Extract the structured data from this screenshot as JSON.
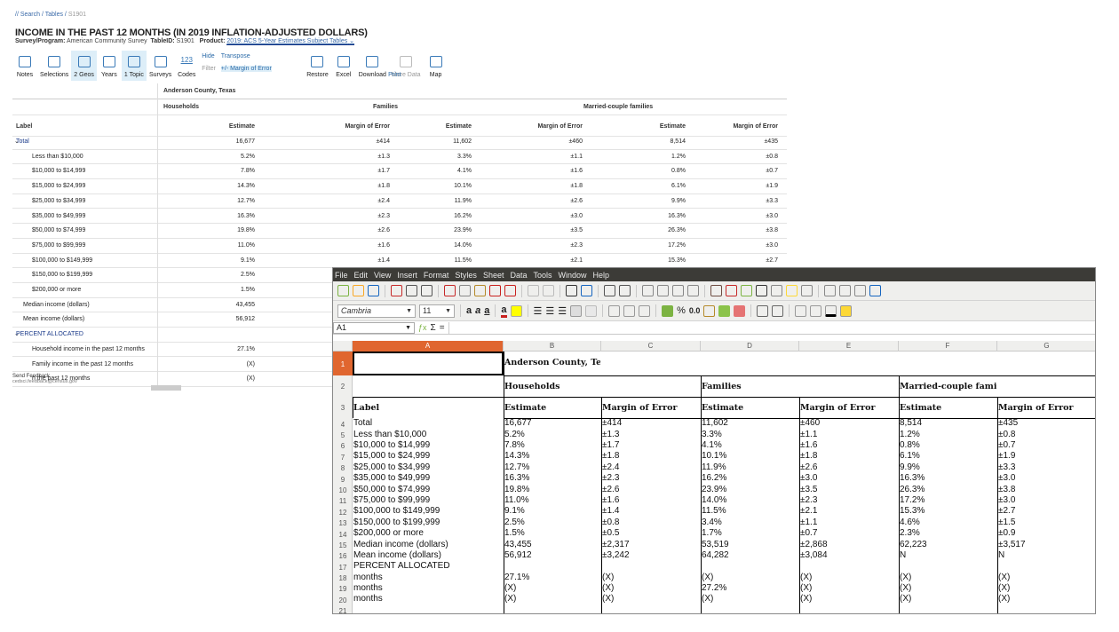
{
  "census": {
    "breadcrumb": [
      "// Search",
      "Tables",
      "S1901"
    ],
    "title": "INCOME IN THE PAST 12 MONTHS (IN 2019 INFLATION-ADJUSTED DOLLARS)",
    "survey_label": "Survey/Program:",
    "survey": "American Community Survey",
    "tableid_label": "TableID:",
    "tableid": "S1901",
    "product_label": "Product:",
    "product": "2019: ACS 5-Year Estimates Subject Tables",
    "toolbar": [
      {
        "label": "Notes",
        "icon": "notes-icon"
      },
      {
        "label": "Selections",
        "icon": "checkmark-icon"
      },
      {
        "label": "2 Geos",
        "icon": "location-pin-icon",
        "active": true
      },
      {
        "label": "Years",
        "icon": "calendar-icon"
      },
      {
        "label": "1 Topic",
        "icon": "topic-icon",
        "active": true
      },
      {
        "label": "Surveys",
        "icon": "clipboard-icon"
      },
      {
        "label": "Codes",
        "icon": "codes-icon",
        "glyph": "123"
      }
    ],
    "toolbar_group": {
      "hide": "Hide",
      "filter": "Filter",
      "transpose": "Transpose",
      "moe": "+/- Margin of Error"
    },
    "toolbar2": [
      {
        "label": "Restore",
        "icon": "undo-icon"
      },
      {
        "label": "Excel",
        "icon": "excel-icon"
      },
      {
        "label": "Download",
        "icon": "download-icon"
      },
      {
        "label": "More Data",
        "icon": "more-data-icon"
      },
      {
        "label": "Map",
        "icon": "map-icon"
      }
    ],
    "print": "Print",
    "geo": "Anderson County, Texas",
    "groups": [
      "Households",
      "Families",
      "Married-couple families"
    ],
    "headers": [
      "Label",
      "Estimate",
      "Margin of Error",
      "Estimate",
      "Margin of Error",
      "Estimate",
      "Margin of Error"
    ],
    "rows": [
      [
        "Total",
        "16,677",
        "±414",
        "11,602",
        "±460",
        "8,514",
        "±435"
      ],
      [
        "Less than $10,000",
        "5.2%",
        "±1.3",
        "3.3%",
        "±1.1",
        "1.2%",
        "±0.8"
      ],
      [
        "$10,000 to $14,999",
        "7.8%",
        "±1.7",
        "4.1%",
        "±1.6",
        "0.8%",
        "±0.7"
      ],
      [
        "$15,000 to $24,999",
        "14.3%",
        "±1.8",
        "10.1%",
        "±1.8",
        "6.1%",
        "±1.9"
      ],
      [
        "$25,000 to $34,999",
        "12.7%",
        "±2.4",
        "11.9%",
        "±2.6",
        "9.9%",
        "±3.3"
      ],
      [
        "$35,000 to $49,999",
        "16.3%",
        "±2.3",
        "16.2%",
        "±3.0",
        "16.3%",
        "±3.0"
      ],
      [
        "$50,000 to $74,999",
        "19.8%",
        "±2.6",
        "23.9%",
        "±3.5",
        "26.3%",
        "±3.8"
      ],
      [
        "$75,000 to $99,999",
        "11.0%",
        "±1.6",
        "14.0%",
        "±2.3",
        "17.2%",
        "±3.0"
      ],
      [
        "$100,000 to $149,999",
        "9.1%",
        "±1.4",
        "11.5%",
        "±2.1",
        "15.3%",
        "±2.7"
      ],
      [
        "$150,000 to $199,999",
        "2.5%",
        "",
        "",
        "",
        "",
        ""
      ],
      [
        "$200,000 or more",
        "1.5%",
        "",
        "",
        "",
        "",
        ""
      ],
      [
        "Median income (dollars)",
        "43,455",
        "",
        "",
        "",
        "",
        ""
      ],
      [
        "Mean income (dollars)",
        "56,912",
        "",
        "",
        "",
        "",
        ""
      ],
      [
        "PERCENT ALLOCATED",
        "",
        "",
        "",
        "",
        "",
        ""
      ],
      [
        "Household income in the past 12 months",
        "27.1%",
        "",
        "",
        "",
        "",
        ""
      ],
      [
        "Family income in the past 12 months",
        "(X)",
        "",
        "",
        "",
        "",
        ""
      ],
      [
        "n the past 12 months",
        "(X)",
        "",
        "",
        "",
        "",
        ""
      ]
    ],
    "feedback": "Send Feedback",
    "feedback_email": "cedsci.feedback@census.gov"
  },
  "calc": {
    "menu": [
      "File",
      "Edit",
      "View",
      "Insert",
      "Format",
      "Styles",
      "Sheet",
      "Data",
      "Tools",
      "Window",
      "Help"
    ],
    "font_name": "Cambria",
    "font_size": "11",
    "percent_btn": "%",
    "number_btn": "0.0",
    "cell_ref": "A1",
    "formula": "",
    "columns": [
      "A",
      "B",
      "C",
      "D",
      "E",
      "F",
      "G"
    ],
    "row_numbers": [
      "1",
      "2",
      "3",
      "4",
      "5",
      "6",
      "7",
      "8",
      "9",
      "10",
      "11",
      "12",
      "13",
      "14",
      "15",
      "16",
      "17",
      "18",
      "19",
      "20",
      "21"
    ],
    "title_cell": "Anderson County, Texas",
    "groups": [
      "Households",
      "Families",
      "Married-couple families"
    ],
    "headers": [
      "Label",
      "Estimate",
      "Margin of Error",
      "Estimate",
      "Margin of Error",
      "Estimate",
      "Margin of Error"
    ],
    "rows": [
      [
        "Total",
        "16,677",
        "±414",
        "11,602",
        "±460",
        "8,514",
        "±435"
      ],
      [
        "Less than $10,000",
        "5.2%",
        "±1.3",
        "3.3%",
        "±1.1",
        "1.2%",
        "±0.8"
      ],
      [
        "$10,000 to $14,999",
        "7.8%",
        "±1.7",
        "4.1%",
        "±1.6",
        "0.8%",
        "±0.7"
      ],
      [
        "$15,000 to $24,999",
        "14.3%",
        "±1.8",
        "10.1%",
        "±1.8",
        "6.1%",
        "±1.9"
      ],
      [
        "$25,000 to $34,999",
        "12.7%",
        "±2.4",
        "11.9%",
        "±2.6",
        "9.9%",
        "±3.3"
      ],
      [
        "$35,000 to $49,999",
        "16.3%",
        "±2.3",
        "16.2%",
        "±3.0",
        "16.3%",
        "±3.0"
      ],
      [
        "$50,000 to $74,999",
        "19.8%",
        "±2.6",
        "23.9%",
        "±3.5",
        "26.3%",
        "±3.8"
      ],
      [
        "$75,000 to $99,999",
        "11.0%",
        "±1.6",
        "14.0%",
        "±2.3",
        "17.2%",
        "±3.0"
      ],
      [
        "$100,000 to $149,999",
        "9.1%",
        "±1.4",
        "11.5%",
        "±2.1",
        "15.3%",
        "±2.7"
      ],
      [
        "$150,000 to $199,999",
        "2.5%",
        "±0.8",
        "3.4%",
        "±1.1",
        "4.6%",
        "±1.5"
      ],
      [
        "$200,000 or more",
        "1.5%",
        "±0.5",
        "1.7%",
        "±0.7",
        "2.3%",
        "±0.9"
      ],
      [
        "Median income (dollars)",
        "43,455",
        "±2,317",
        "53,519",
        "±2,868",
        "62,223",
        "±3,517"
      ],
      [
        "Mean income (dollars)",
        "56,912",
        "±3,242",
        "64,282",
        "±3,084",
        "N",
        "N"
      ],
      [
        "PERCENT ALLOCATED",
        "",
        "",
        "",
        "",
        "",
        ""
      ],
      [
        "months",
        "27.1%",
        "(X)",
        "(X)",
        "(X)",
        "(X)",
        "(X)"
      ],
      [
        "months",
        "(X)",
        "(X)",
        "27.2%",
        "(X)",
        "(X)",
        "(X)"
      ],
      [
        "months",
        "(X)",
        "(X)",
        "(X)",
        "(X)",
        "(X)",
        "(X)"
      ]
    ]
  },
  "colors": {
    "accent": "#e0662f",
    "link": "#3a6aa8",
    "menubar": "#3c3b37"
  }
}
